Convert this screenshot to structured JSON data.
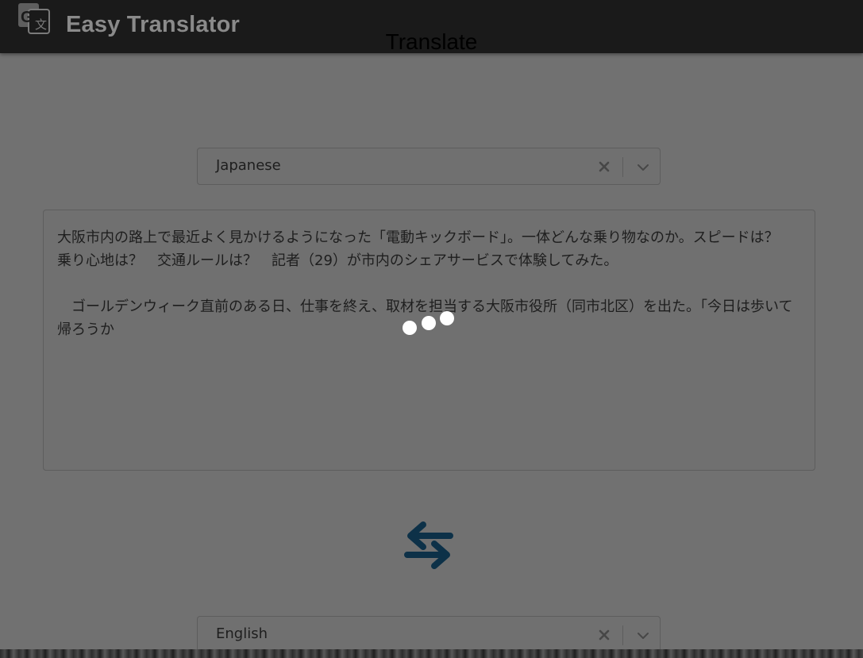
{
  "header": {
    "app_title": "Easy Translator",
    "logo_icon": "google-translate-icon"
  },
  "main": {
    "title": "Translate",
    "source_language": {
      "value": "Japanese",
      "clear_icon": "close-icon",
      "dropdown_icon": "chevron-down-icon"
    },
    "source_text": "大阪市内の路上で最近よく見かけるようになった「電動キックボード」。一体どんな乗り物なのか。スピードは？　乗り心地は？　交通ルールは？　記者（29）が市内のシェアサービスで体験してみた。\n\n　ゴールデンウィーク直前のある日、仕事を終え、取材を担当する大阪市役所（同市北区）を出た。「今日は歩いて帰ろうか",
    "loading_indicator": "loading-dots",
    "swap_icon": "swap-arrows-icon",
    "target_language": {
      "value": "English",
      "clear_icon": "close-icon",
      "dropdown_icon": "chevron-down-icon"
    }
  },
  "colors": {
    "header_bg": "#1a1a1a",
    "overlay_bg": "#717171",
    "swap_icon": "#0d3148",
    "loading_dots": "#ffffff"
  }
}
